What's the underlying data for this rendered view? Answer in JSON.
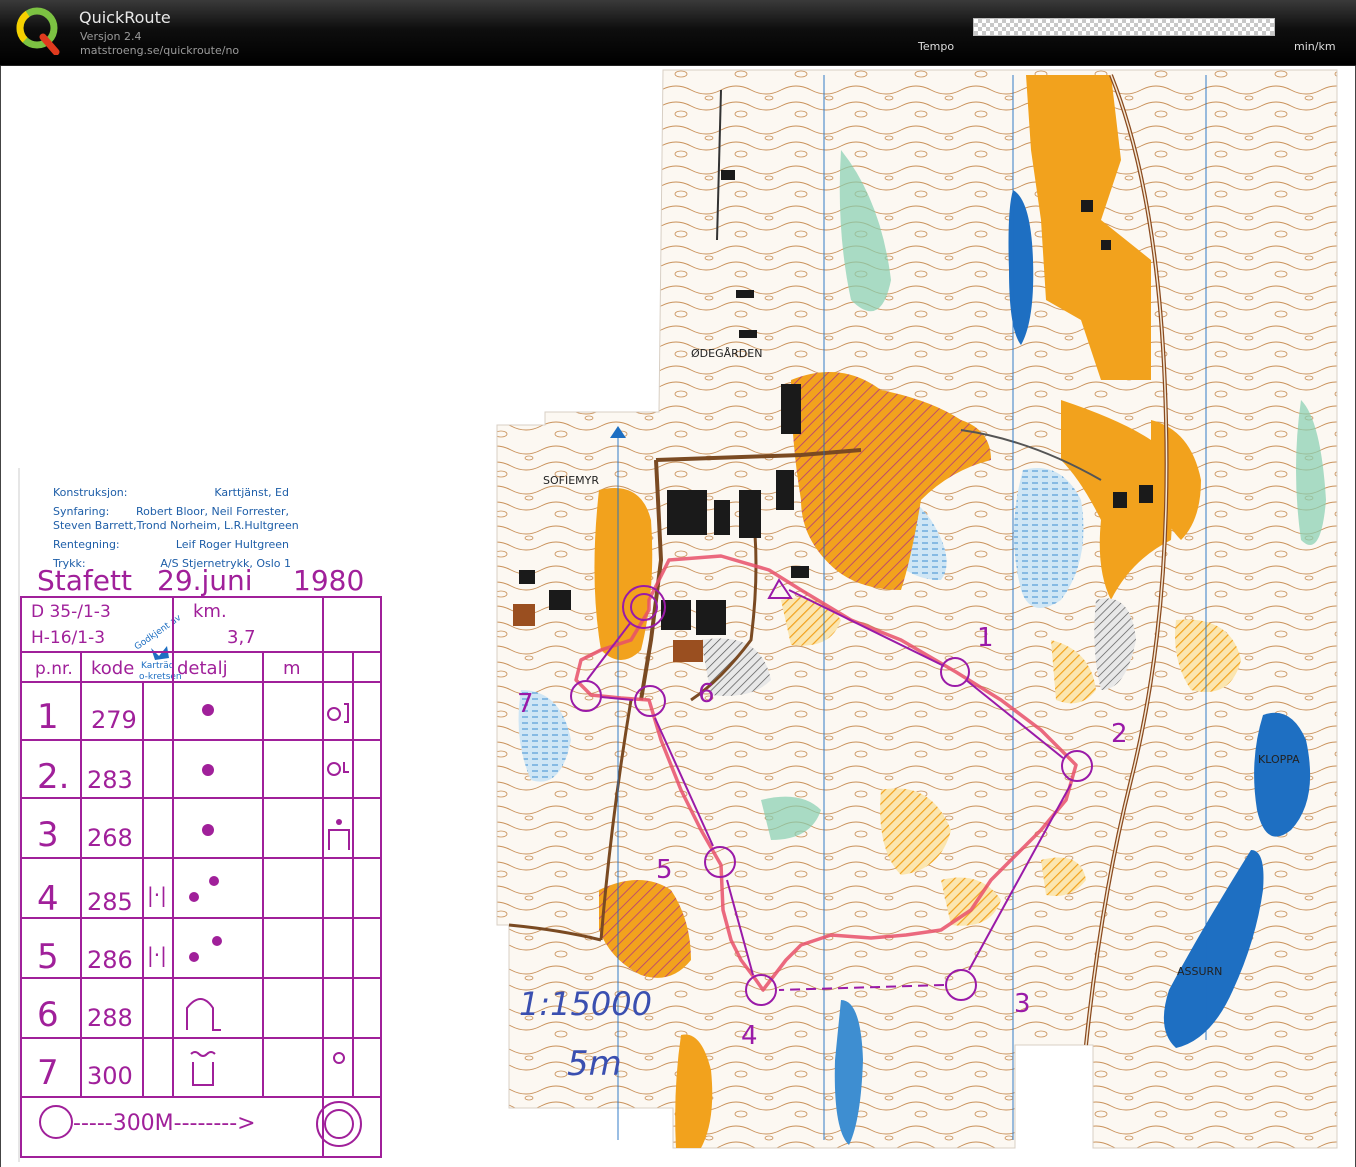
{
  "app": {
    "title": "QuickRoute",
    "version": "Versjon 2.4",
    "url": "matstroeng.se/quickroute/no"
  },
  "tempo_scale": {
    "label": "Tempo",
    "unit": "min/km"
  },
  "map": {
    "place_names": [
      "ØDEGÅRDEN",
      "SOFIEMYR",
      "KLOPPA",
      "ASSURN"
    ],
    "handwritten_scale": "1:15000",
    "handwritten_contour": "5m",
    "control_labels": [
      "1",
      "2",
      "3",
      "4",
      "5",
      "6",
      "7"
    ],
    "colors": {
      "course": "#9a1aa8",
      "route": "#e8506a",
      "open_land": "#f2a21d",
      "water": "#1e6fc2",
      "marsh_blue": "#74b6e4",
      "green": "#86cfb0",
      "contour": "#b87a3a"
    }
  },
  "legend": {
    "credits": [
      {
        "label": "Konstruksjon:",
        "value": "Karttjänst, Ed"
      },
      {
        "label": "Synfaring:",
        "value": "Robert Bloor, Neil Forrester,"
      },
      {
        "label": "",
        "value": "Steven Barrett,Trond Norheim,  L.R.Hultgreen"
      },
      {
        "label": "Rentegning:",
        "value": "Leif Roger Hultgreen"
      },
      {
        "label": "Trykk:",
        "value": "A/S Stjernetrykk, Oslo 1"
      }
    ],
    "event_title": "Stafett",
    "event_date": "29.juni",
    "event_year": "1980",
    "classes_1": "D 35-/1-3",
    "classes_2": "H-16/1-3",
    "km_label": "km.",
    "km_value": "3,7",
    "stamp_text_1": "Godkjent av",
    "stamp_text_2": "Karträd",
    "stamp_text_3": "o-kretsen",
    "header_pnr": "p.nr.",
    "header_kode": "kode",
    "header_detalj": "detalj",
    "header_m": "m",
    "rows": [
      {
        "num": "1",
        "code": "279"
      },
      {
        "num": "2.",
        "code": "283"
      },
      {
        "num": "3",
        "code": "268"
      },
      {
        "num": "4",
        "code": "285"
      },
      {
        "num": "5",
        "code": "286"
      },
      {
        "num": "6",
        "code": "288"
      },
      {
        "num": "7",
        "code": "300"
      }
    ],
    "finish_text": "-----300M-------->"
  }
}
